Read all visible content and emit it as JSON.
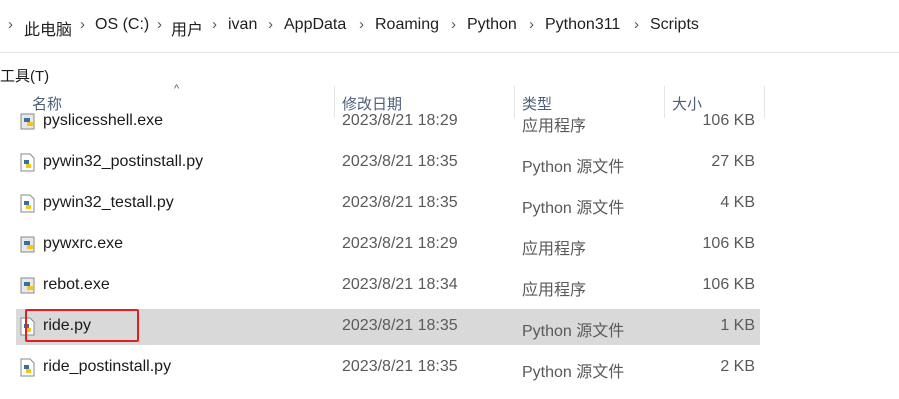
{
  "breadcrumb": [
    "此电脑",
    "OS (C:)",
    "用户",
    "ivan",
    "AppData",
    "Roaming",
    "Python",
    "Python311",
    "Scripts"
  ],
  "menu": {
    "tools": "工具(T)"
  },
  "columns": {
    "name": "名称",
    "modified": "修改日期",
    "type": "类型",
    "size": "大小"
  },
  "files": [
    {
      "name": "pyslicesshell.exe",
      "modified": "2023/8/21 18:29",
      "type": "应用程序",
      "size": "106 KB",
      "icon": "exe-python-icon"
    },
    {
      "name": "pywin32_postinstall.py",
      "modified": "2023/8/21 18:35",
      "type": "Python 源文件",
      "size": "27 KB",
      "icon": "py-file-icon"
    },
    {
      "name": "pywin32_testall.py",
      "modified": "2023/8/21 18:35",
      "type": "Python 源文件",
      "size": "4 KB",
      "icon": "py-file-icon"
    },
    {
      "name": "pywxrc.exe",
      "modified": "2023/8/21 18:29",
      "type": "应用程序",
      "size": "106 KB",
      "icon": "exe-python-icon"
    },
    {
      "name": "rebot.exe",
      "modified": "2023/8/21 18:34",
      "type": "应用程序",
      "size": "106 KB",
      "icon": "exe-python-icon"
    },
    {
      "name": "ride.py",
      "modified": "2023/8/21 18:35",
      "type": "Python 源文件",
      "size": "1 KB",
      "icon": "py-file-icon",
      "selected": true
    },
    {
      "name": "ride_postinstall.py",
      "modified": "2023/8/21 18:35",
      "type": "Python 源文件",
      "size": "2 KB",
      "icon": "py-file-icon"
    }
  ],
  "colors": {
    "selection": "#d9d9d9",
    "highlight_box": "#e02020",
    "header_text": "#4c607a"
  }
}
